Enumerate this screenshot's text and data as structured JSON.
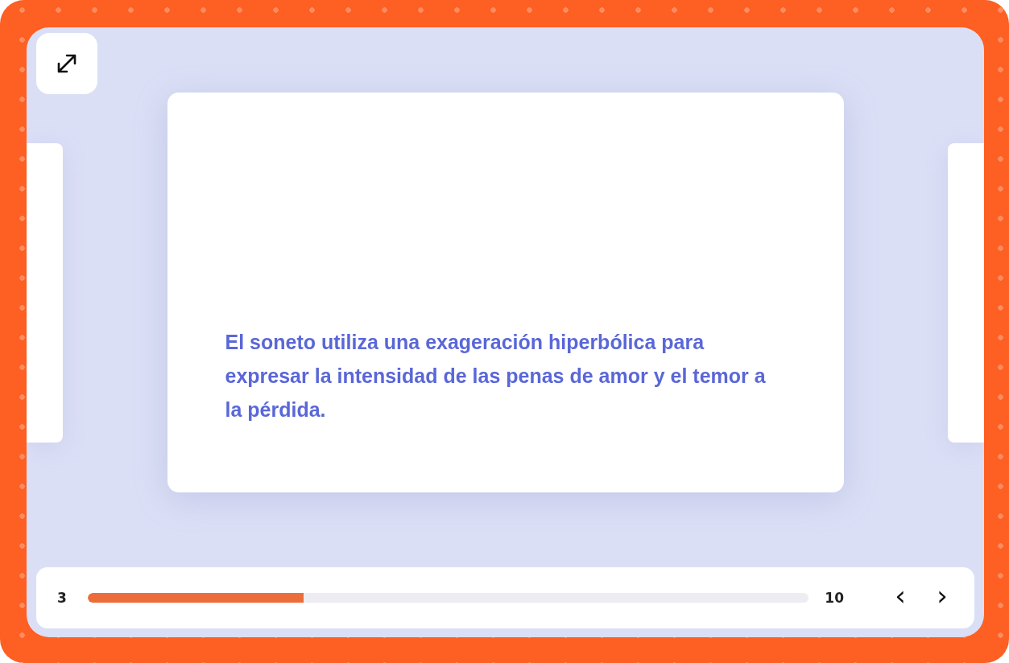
{
  "card": {
    "text": "El soneto utiliza una exageración hiperbólica para expresar la intensidad de las penas de amor y el temor a la pérdida."
  },
  "progress": {
    "current": "3",
    "total": "10",
    "level": 0.3
  },
  "navigation": {
    "previous": "‹",
    "next": "›"
  }
}
